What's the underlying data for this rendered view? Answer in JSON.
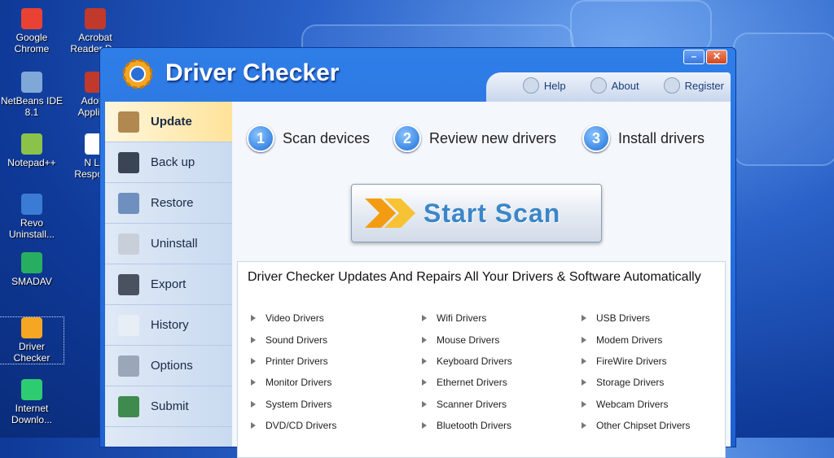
{
  "desktop": [
    {
      "label": "Google Chrome",
      "icon": "chrome-icon"
    },
    {
      "label": "Acrobat Reader D...",
      "icon": "acrobat-icon"
    },
    {
      "label": "NetBeans IDE 8.1",
      "icon": "netbeans-icon"
    },
    {
      "label": "Adobe Applic...",
      "icon": "adobe-icon"
    },
    {
      "label": "Notepad++",
      "icon": "notepad-icon"
    },
    {
      "label": "N Lic Respon...",
      "icon": "document-icon"
    },
    {
      "label": "Revo Uninstall...",
      "icon": "revo-icon"
    },
    {
      "label": "SMADAV",
      "icon": "smadav-icon"
    },
    {
      "label": "Driver Checker",
      "icon": "driver-checker-icon"
    },
    {
      "label": "Internet Downlo...",
      "icon": "idm-icon"
    }
  ],
  "window": {
    "title": "Driver Checker",
    "minimize": "–",
    "close": "✕",
    "nav": {
      "help": "Help",
      "about": "About",
      "register": "Register"
    }
  },
  "sidebar": {
    "items": [
      {
        "label": "Update",
        "icon": "box-icon",
        "color": "#b08850"
      },
      {
        "label": "Back up",
        "icon": "floppy-icon",
        "color": "#3a4455"
      },
      {
        "label": "Restore",
        "icon": "restore-icon",
        "color": "#6f8fbf"
      },
      {
        "label": "Uninstall",
        "icon": "uninstall-icon",
        "color": "#c9cfd8"
      },
      {
        "label": "Export",
        "icon": "export-icon",
        "color": "#4a5260"
      },
      {
        "label": "History",
        "icon": "clock-icon",
        "color": "#e8eef6"
      },
      {
        "label": "Options",
        "icon": "gear-icon",
        "color": "#9aa7b8"
      },
      {
        "label": "Submit",
        "icon": "submit-icon",
        "color": "#3f8a4e"
      }
    ]
  },
  "steps": [
    {
      "num": "1",
      "label": "Scan devices"
    },
    {
      "num": "2",
      "label": "Review new drivers"
    },
    {
      "num": "3",
      "label": "Install drivers"
    }
  ],
  "scan_button": "Start Scan",
  "panel": {
    "title": "Driver Checker Updates And Repairs All Your Drivers & Software Automatically",
    "columns": [
      [
        "Video Drivers",
        "Sound Drivers",
        "Printer Drivers",
        "Monitor Drivers",
        "System Drivers",
        "DVD/CD  Drivers"
      ],
      [
        "Wifi Drivers",
        "Mouse Drivers",
        "Keyboard Drivers",
        "Ethernet Drivers",
        "Scanner Drivers",
        "Bluetooth Drivers"
      ],
      [
        "USB Drivers",
        "Modem Drivers",
        "FireWire Drivers",
        "Storage Drivers",
        "Webcam Drivers",
        "Other Chipset Drivers"
      ]
    ]
  },
  "colors": {
    "accent": "#3b86c8",
    "title_bar": "#1f5fd0",
    "active_item": "#ffe39a"
  }
}
